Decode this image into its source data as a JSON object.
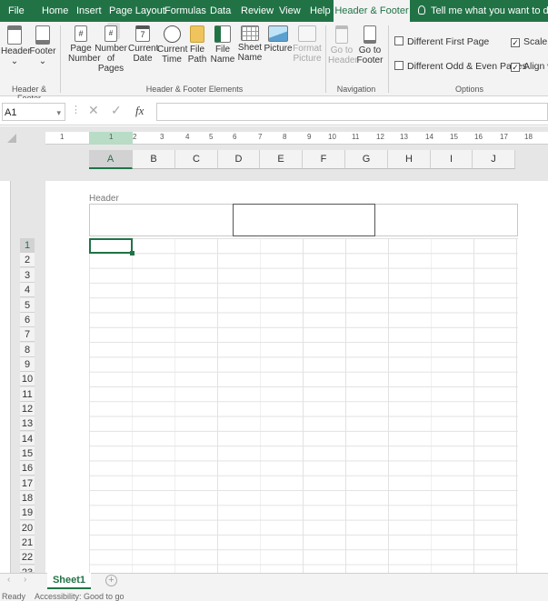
{
  "ribbon_tabs": [
    {
      "label": "File"
    },
    {
      "label": "Home"
    },
    {
      "label": "Insert"
    },
    {
      "label": "Page Layout"
    },
    {
      "label": "Formulas"
    },
    {
      "label": "Data"
    },
    {
      "label": "Review"
    },
    {
      "label": "View"
    },
    {
      "label": "Help"
    },
    {
      "label": "Header & Footer",
      "active": true
    },
    {
      "label": "Tell me what you want to do"
    }
  ],
  "ribbon": {
    "hf_group": {
      "label": "Header & Footer",
      "header_label": "Header",
      "footer_label": "Footer"
    },
    "elements_group": {
      "label": "Header & Footer Elements",
      "buttons": [
        {
          "line1": "Page",
          "line2": "Number",
          "enabled": true
        },
        {
          "line1": "Number",
          "line2": "of Pages",
          "enabled": true
        },
        {
          "line1": "Current",
          "line2": "Date",
          "enabled": true
        },
        {
          "line1": "Current",
          "line2": "Time",
          "enabled": true
        },
        {
          "line1": "File",
          "line2": "Path",
          "enabled": true
        },
        {
          "line1": "File",
          "line2": "Name",
          "enabled": true
        },
        {
          "line1": "Sheet",
          "line2": "Name",
          "enabled": true
        },
        {
          "line1": "Picture",
          "line2": "",
          "enabled": true
        },
        {
          "line1": "Format",
          "line2": "Picture",
          "enabled": false
        }
      ]
    },
    "navigation_group": {
      "label": "Navigation",
      "goto_header_1": "Go to",
      "goto_header_2": "Header",
      "goto_footer_1": "Go to",
      "goto_footer_2": "Footer"
    },
    "options_group": {
      "label": "Options",
      "items": [
        {
          "label": "Different First Page",
          "checked": false
        },
        {
          "label": "Scale w",
          "checked": true
        },
        {
          "label": "Different Odd & Even Pages",
          "checked": false
        },
        {
          "label": "Align w",
          "checked": true
        }
      ]
    }
  },
  "formula_bar": {
    "name_box": "A1",
    "fx": "fx",
    "value": ""
  },
  "ruler_numbers": [
    "1",
    "1",
    "2",
    "3",
    "4",
    "5",
    "6",
    "7",
    "8",
    "9",
    "10",
    "11",
    "12",
    "13",
    "14",
    "15",
    "16",
    "17",
    "18"
  ],
  "columns": [
    "A",
    "B",
    "C",
    "D",
    "E",
    "F",
    "G",
    "H",
    "I",
    "J"
  ],
  "rows": [
    "1",
    "2",
    "3",
    "4",
    "5",
    "6",
    "7",
    "8",
    "9",
    "10",
    "11",
    "12",
    "13",
    "14",
    "15",
    "16",
    "17",
    "18",
    "19",
    "20",
    "21",
    "22",
    "23"
  ],
  "header_area": {
    "label": "Header"
  },
  "sheet_tabs": [
    {
      "label": "Sheet1",
      "active": true
    }
  ],
  "status": {
    "ready": "Ready",
    "accessibility": "Accessibility: Good to go"
  },
  "colors": {
    "accent": "#217346",
    "ribbon_bg": "#f3f3f3",
    "sheet_bg": "#e6e6e6"
  }
}
